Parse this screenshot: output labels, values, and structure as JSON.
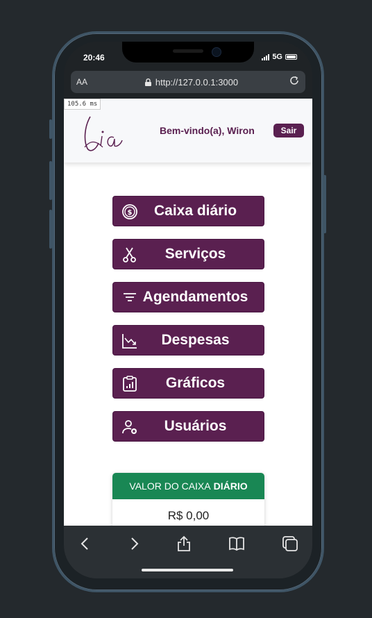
{
  "status": {
    "time": "20:46",
    "network": "5G"
  },
  "browser": {
    "text_size": "AA",
    "url": "http://127.0.0.1:3000"
  },
  "perf_overlay": "105.6 ms",
  "header": {
    "welcome": "Bem-vindo(a), Wiron",
    "logout_label": "Sair"
  },
  "menu": [
    {
      "label": "Caixa diário",
      "icon": "dollar-circle-icon"
    },
    {
      "label": "Serviços",
      "icon": "scissors-icon"
    },
    {
      "label": "Agendamentos",
      "icon": "filter-list-icon"
    },
    {
      "label": "Despesas",
      "icon": "chart-down-icon"
    },
    {
      "label": "Gráficos",
      "icon": "clipboard-chart-icon"
    },
    {
      "label": "Usuários",
      "icon": "user-add-icon"
    }
  ],
  "cash_card": {
    "title_prefix": "VALOR DO CAIXA",
    "title_bold": "DIÁRIO",
    "value": "R$ 0,00"
  },
  "colors": {
    "brand": "#5a2050",
    "success": "#198754",
    "page_bg": "#24292d"
  }
}
